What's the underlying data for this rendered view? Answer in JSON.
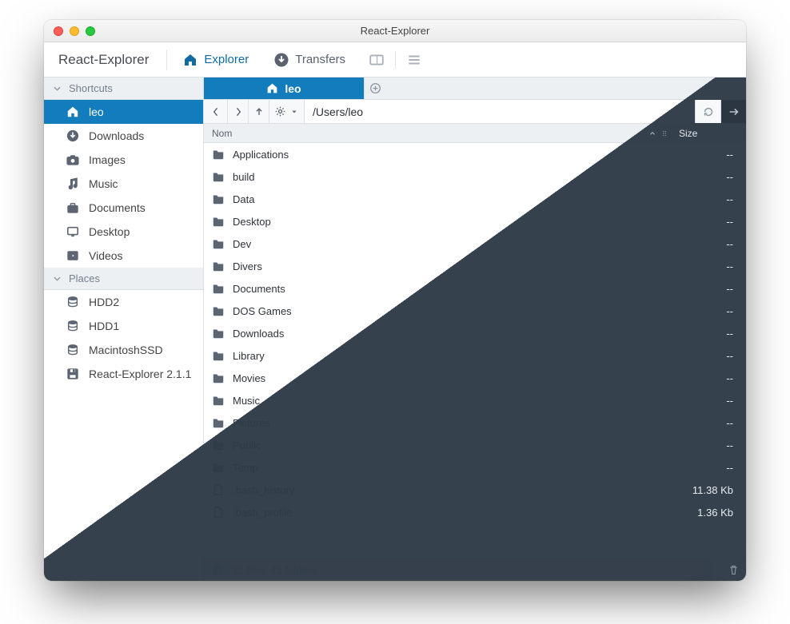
{
  "window": {
    "title": "React-Explorer"
  },
  "appbar": {
    "brand": "React-Explorer",
    "nav": {
      "explorer": "Explorer",
      "transfers": "Transfers"
    }
  },
  "sidebar": {
    "sections": [
      {
        "title": "Shortcuts",
        "items": [
          {
            "icon": "home",
            "label": "leo",
            "active": true
          },
          {
            "icon": "download",
            "label": "Downloads"
          },
          {
            "icon": "camera",
            "label": "Images"
          },
          {
            "icon": "music",
            "label": "Music"
          },
          {
            "icon": "briefcase",
            "label": "Documents"
          },
          {
            "icon": "desktop",
            "label": "Desktop"
          },
          {
            "icon": "play",
            "label": "Videos"
          }
        ]
      },
      {
        "title": "Places",
        "items": [
          {
            "icon": "database",
            "label": "HDD2"
          },
          {
            "icon": "database",
            "label": "HDD1"
          },
          {
            "icon": "database",
            "label": "MacintoshSSD"
          },
          {
            "icon": "floppy",
            "label": "React-Explorer 2.1.1"
          }
        ]
      }
    ]
  },
  "tabs": {
    "active": {
      "icon": "home",
      "label": "leo"
    }
  },
  "path": {
    "value": "/Users/leo"
  },
  "columns": {
    "name": "Nom",
    "size": "Size"
  },
  "files": [
    {
      "icon": "folder",
      "name": "Applications",
      "size": "--"
    },
    {
      "icon": "folder",
      "name": "build",
      "size": "--"
    },
    {
      "icon": "folder",
      "name": "Data",
      "size": "--"
    },
    {
      "icon": "folder",
      "name": "Desktop",
      "size": "--"
    },
    {
      "icon": "folder",
      "name": "Dev",
      "size": "--"
    },
    {
      "icon": "folder",
      "name": "Divers",
      "size": "--"
    },
    {
      "icon": "folder",
      "name": "Documents",
      "size": "--"
    },
    {
      "icon": "folder",
      "name": "DOS Games",
      "size": "--"
    },
    {
      "icon": "folder",
      "name": "Downloads",
      "size": "--"
    },
    {
      "icon": "folder",
      "name": "Library",
      "size": "--"
    },
    {
      "icon": "folder",
      "name": "Movies",
      "size": "--"
    },
    {
      "icon": "folder",
      "name": "Music",
      "size": "--"
    },
    {
      "icon": "folder",
      "name": "Pictures",
      "size": "--"
    },
    {
      "icon": "folder",
      "name": "Public",
      "size": "--"
    },
    {
      "icon": "folder",
      "name": "Temp",
      "size": "--"
    },
    {
      "icon": "file",
      "name": ".bash_history",
      "size": "11.38 Kb"
    },
    {
      "icon": "file",
      "name": ".bash_profile",
      "size": "1.36 Kb"
    }
  ],
  "status": {
    "text": "35 files, 45 folders"
  }
}
